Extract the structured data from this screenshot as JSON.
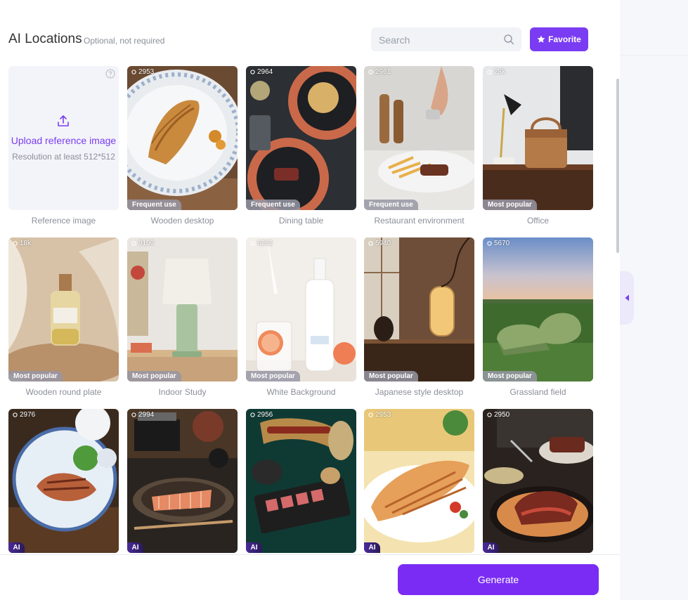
{
  "header": {
    "title": "AI Locations",
    "subtitle": "Optional, not required",
    "search_placeholder": "Search",
    "favorite_label": "Favorite"
  },
  "upload": {
    "title": "Upload reference image",
    "subtitle": "Resolution at least 512*512",
    "label": "Reference image"
  },
  "locations": [
    {
      "count": "2953",
      "tag": "Frequent use",
      "label": "Wooden desktop"
    },
    {
      "count": "2964",
      "tag": "Frequent use",
      "label": "Dining table"
    },
    {
      "count": "2961",
      "tag": "Frequent use",
      "label": "Restaurant environment"
    },
    {
      "count": "28k",
      "tag": "Most popular",
      "label": "Office"
    },
    {
      "count": "18k",
      "tag": "Most popular",
      "label": "Wooden round plate"
    },
    {
      "count": "9109",
      "tag": "Most popular",
      "label": "Indoor Study"
    },
    {
      "count": "6262",
      "tag": "Most popular",
      "label": "White Background"
    },
    {
      "count": "5940",
      "tag": "Most popular",
      "label": "Japanese style desktop"
    },
    {
      "count": "5670",
      "tag": "Most popular",
      "label": "Grassland field"
    },
    {
      "count": "2976",
      "tag": "AI",
      "label": ""
    },
    {
      "count": "2994",
      "tag": "AI",
      "label": ""
    },
    {
      "count": "2956",
      "tag": "AI",
      "label": ""
    },
    {
      "count": "2953",
      "tag": "AI",
      "label": ""
    },
    {
      "count": "2950",
      "tag": "AI",
      "label": ""
    }
  ],
  "footer": {
    "generate_label": "Generate"
  },
  "colors": {
    "accent": "#7a3cf2",
    "generate": "#7a2cf5"
  }
}
